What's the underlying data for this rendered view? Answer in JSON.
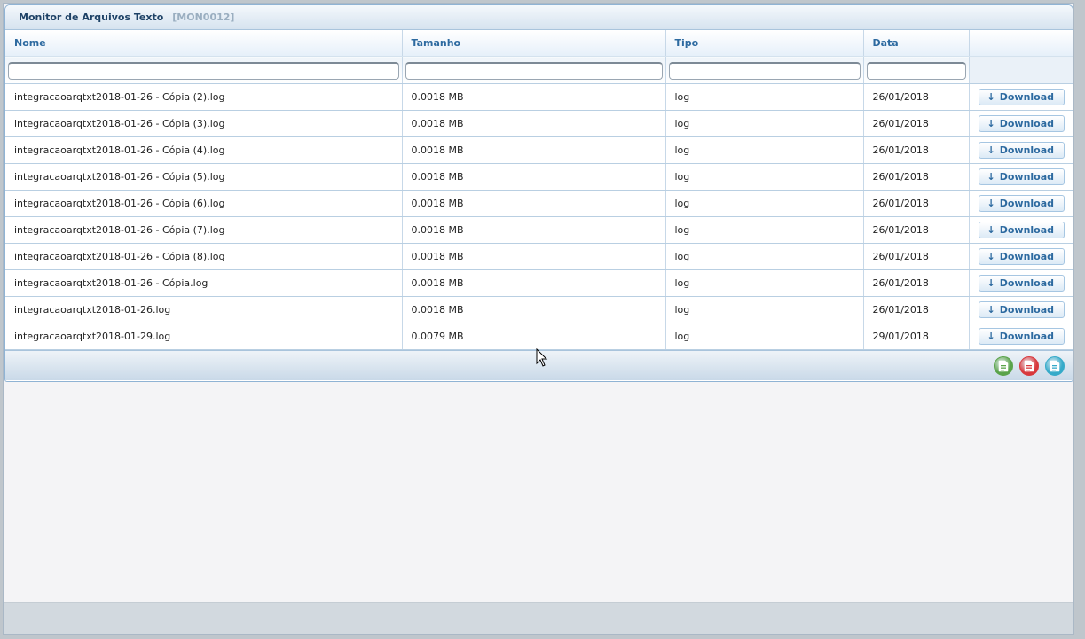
{
  "panel": {
    "title": "Monitor de Arquivos Texto",
    "code": "[MON0012]"
  },
  "table": {
    "columns": [
      "Nome",
      "Tamanho",
      "Tipo",
      "Data"
    ],
    "download_label": "Download",
    "rows": [
      {
        "nome": "integracaoarqtxt2018-01-26 - Cópia (2).log",
        "tamanho": "0.0018 MB",
        "tipo": "log",
        "data": "26/01/2018"
      },
      {
        "nome": "integracaoarqtxt2018-01-26 - Cópia (3).log",
        "tamanho": "0.0018 MB",
        "tipo": "log",
        "data": "26/01/2018"
      },
      {
        "nome": "integracaoarqtxt2018-01-26 - Cópia (4).log",
        "tamanho": "0.0018 MB",
        "tipo": "log",
        "data": "26/01/2018"
      },
      {
        "nome": "integracaoarqtxt2018-01-26 - Cópia (5).log",
        "tamanho": "0.0018 MB",
        "tipo": "log",
        "data": "26/01/2018"
      },
      {
        "nome": "integracaoarqtxt2018-01-26 - Cópia (6).log",
        "tamanho": "0.0018 MB",
        "tipo": "log",
        "data": "26/01/2018"
      },
      {
        "nome": "integracaoarqtxt2018-01-26 - Cópia (7).log",
        "tamanho": "0.0018 MB",
        "tipo": "log",
        "data": "26/01/2018"
      },
      {
        "nome": "integracaoarqtxt2018-01-26 - Cópia (8).log",
        "tamanho": "0.0018 MB",
        "tipo": "log",
        "data": "26/01/2018"
      },
      {
        "nome": "integracaoarqtxt2018-01-26 - Cópia.log",
        "tamanho": "0.0018 MB",
        "tipo": "log",
        "data": "26/01/2018"
      },
      {
        "nome": "integracaoarqtxt2018-01-26.log",
        "tamanho": "0.0018 MB",
        "tipo": "log",
        "data": "26/01/2018"
      },
      {
        "nome": "integracaoarqtxt2018-01-29.log",
        "tamanho": "0.0079 MB",
        "tipo": "log",
        "data": "29/01/2018"
      }
    ]
  },
  "footer": {
    "export_buttons": [
      {
        "icon": "export-excel-icon",
        "color": "#5aa34a"
      },
      {
        "icon": "export-pdf-icon",
        "color": "#d8393d"
      },
      {
        "icon": "export-csv-icon",
        "color": "#35aac9"
      }
    ]
  },
  "colors": {
    "header_text": "#2d6aa0",
    "title_text": "#1e4266",
    "border": "#b9cfe2"
  }
}
